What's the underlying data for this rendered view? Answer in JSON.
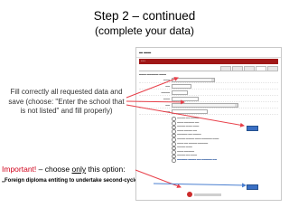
{
  "slide": {
    "title": "Step 2 – continued",
    "subtitle": "(complete your data)",
    "note": "Fill correctly all requested data and save (choose:  \"Enter the school that is not listed\" and fill properly)",
    "important_label": "Important!",
    "important_pre": " – choose ",
    "important_only": "only",
    "important_post": " this option:",
    "option_quote": "„Foreign diploma entiting to undertake second-cycle (MA) studies\""
  },
  "colors": {
    "arrow": "#e8404a",
    "arrow_blue": "#4a7fd0",
    "menu_bar": "#a01818",
    "important": "#d0021b"
  },
  "embedded_screenshot": {
    "description_icon": "web-form-screenshot"
  }
}
